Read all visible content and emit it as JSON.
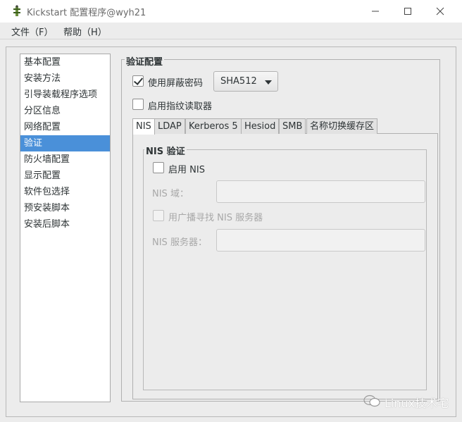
{
  "window": {
    "title": "Kickstart 配置程序@wyh21",
    "icon": "kickstart-app-icon"
  },
  "menu": {
    "file": "文件（F）",
    "help": "帮助（H）"
  },
  "sidebar": {
    "items": [
      {
        "label": "基本配置"
      },
      {
        "label": "安装方法"
      },
      {
        "label": "引导装载程序选项"
      },
      {
        "label": "分区信息"
      },
      {
        "label": "网络配置"
      },
      {
        "label": "验证"
      },
      {
        "label": "防火墙配置"
      },
      {
        "label": "显示配置"
      },
      {
        "label": "软件包选择"
      },
      {
        "label": "预安装脚本"
      },
      {
        "label": "安装后脚本"
      }
    ],
    "selected": "验证"
  },
  "auth": {
    "group_title": "验证配置",
    "shadow_password": {
      "label": "使用屏蔽密码",
      "checked": true
    },
    "hash_algorithm": {
      "value": "SHA512"
    },
    "fingerprint": {
      "label": "启用指纹读取器",
      "checked": false
    }
  },
  "tabs": [
    {
      "label": "NIS",
      "active": true
    },
    {
      "label": "LDAP"
    },
    {
      "label": "Kerberos 5"
    },
    {
      "label": "Hesiod"
    },
    {
      "label": "SMB"
    },
    {
      "label": "名称切换缓存区"
    }
  ],
  "nis": {
    "frame_title": "NIS 验证",
    "enable": {
      "label": "启用 NIS",
      "checked": false
    },
    "domain_label": "NIS 域：",
    "domain_value": "",
    "broadcast": {
      "label": "用广播寻找 NIS 服务器",
      "checked": false
    },
    "server_label": "NIS 服务器：",
    "server_value": ""
  },
  "watermark": {
    "text": "Linux技术宅"
  }
}
